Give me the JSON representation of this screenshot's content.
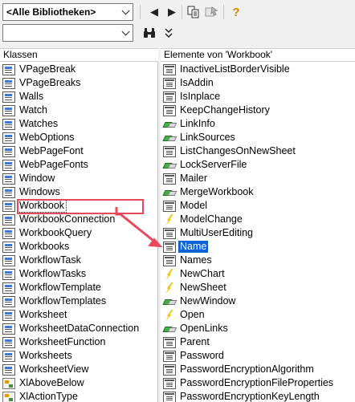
{
  "toolbar": {
    "library_combo": "<Alle Bibliotheken>",
    "search_value": "",
    "icons": [
      "back-icon",
      "forward-icon",
      "copy-icon",
      "view-definition-icon",
      "help-icon",
      "binoculars-icon",
      "expand-icon"
    ]
  },
  "classes_header": "Klassen",
  "members_header": "Elemente von 'Workbook'",
  "classes": [
    {
      "label": "VPageBreak",
      "icon": "class"
    },
    {
      "label": "VPageBreaks",
      "icon": "class"
    },
    {
      "label": "Walls",
      "icon": "class"
    },
    {
      "label": "Watch",
      "icon": "class"
    },
    {
      "label": "Watches",
      "icon": "class"
    },
    {
      "label": "WebOptions",
      "icon": "class"
    },
    {
      "label": "WebPageFont",
      "icon": "class"
    },
    {
      "label": "WebPageFonts",
      "icon": "class"
    },
    {
      "label": "Window",
      "icon": "class"
    },
    {
      "label": "Windows",
      "icon": "class"
    },
    {
      "label": "Workbook",
      "icon": "class"
    },
    {
      "label": "WorkbookConnection",
      "icon": "class"
    },
    {
      "label": "WorkbookQuery",
      "icon": "class"
    },
    {
      "label": "Workbooks",
      "icon": "class"
    },
    {
      "label": "WorkflowTask",
      "icon": "class"
    },
    {
      "label": "WorkflowTasks",
      "icon": "class"
    },
    {
      "label": "WorkflowTemplate",
      "icon": "class"
    },
    {
      "label": "WorkflowTemplates",
      "icon": "class"
    },
    {
      "label": "Worksheet",
      "icon": "class"
    },
    {
      "label": "WorksheetDataConnection",
      "icon": "class"
    },
    {
      "label": "WorksheetFunction",
      "icon": "class"
    },
    {
      "label": "Worksheets",
      "icon": "class"
    },
    {
      "label": "WorksheetView",
      "icon": "class"
    },
    {
      "label": "XlAboveBelow",
      "icon": "enum"
    },
    {
      "label": "XlActionType",
      "icon": "enum"
    }
  ],
  "members": [
    {
      "label": "InactiveListBorderVisible",
      "icon": "prop"
    },
    {
      "label": "IsAddin",
      "icon": "prop"
    },
    {
      "label": "IsInplace",
      "icon": "prop"
    },
    {
      "label": "KeepChangeHistory",
      "icon": "prop"
    },
    {
      "label": "LinkInfo",
      "icon": "method"
    },
    {
      "label": "LinkSources",
      "icon": "method"
    },
    {
      "label": "ListChangesOnNewSheet",
      "icon": "prop"
    },
    {
      "label": "LockServerFile",
      "icon": "method"
    },
    {
      "label": "Mailer",
      "icon": "prop"
    },
    {
      "label": "MergeWorkbook",
      "icon": "method"
    },
    {
      "label": "Model",
      "icon": "prop"
    },
    {
      "label": "ModelChange",
      "icon": "event"
    },
    {
      "label": "MultiUserEditing",
      "icon": "prop"
    },
    {
      "label": "Name",
      "icon": "prop"
    },
    {
      "label": "Names",
      "icon": "prop"
    },
    {
      "label": "NewChart",
      "icon": "event"
    },
    {
      "label": "NewSheet",
      "icon": "event"
    },
    {
      "label": "NewWindow",
      "icon": "method"
    },
    {
      "label": "Open",
      "icon": "event"
    },
    {
      "label": "OpenLinks",
      "icon": "method"
    },
    {
      "label": "Parent",
      "icon": "prop"
    },
    {
      "label": "Password",
      "icon": "prop"
    },
    {
      "label": "PasswordEncryptionAlgorithm",
      "icon": "prop"
    },
    {
      "label": "PasswordEncryptionFileProperties",
      "icon": "prop"
    },
    {
      "label": "PasswordEncryptionKeyLength",
      "icon": "prop"
    }
  ],
  "selected_class": "Workbook",
  "selected_member": "Name",
  "colors": {
    "selection": "#0a64d8",
    "annotation": "#e8495a"
  }
}
